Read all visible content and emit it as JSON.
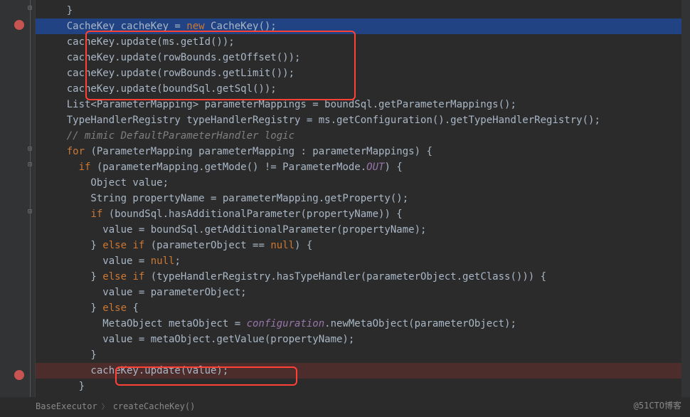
{
  "breadcrumb": {
    "class": "BaseExecutor",
    "method": "createCacheKey()"
  },
  "watermark": "@51CTO博客",
  "code": {
    "l0": "    }",
    "l1_pre": "    CacheKey cacheKey = ",
    "l1_kw": "new",
    "l1_post": " CacheKey();",
    "l2": "    cacheKey.update(ms.getId());",
    "l3": "    cacheKey.update(rowBounds.getOffset());",
    "l4": "    cacheKey.update(rowBounds.getLimit());",
    "l5": "    cacheKey.update(boundSql.getSql());",
    "l6": "    List<ParameterMapping> parameterMappings = boundSql.getParameterMappings();",
    "l7": "    TypeHandlerRegistry typeHandlerRegistry = ms.getConfiguration().getTypeHandlerRegistry();",
    "l8": "    // mimic DefaultParameterHandler logic",
    "l9_kw": "for",
    "l9": " (ParameterMapping parameterMapping : parameterMappings) {",
    "l10_kw": "if",
    "l10_a": " (parameterMapping.getMode() != ParameterMode.",
    "l10_field": "OUT",
    "l10_b": ") {",
    "l11": "        Object value;",
    "l12": "        String propertyName = parameterMapping.getProperty();",
    "l13_kw": "if",
    "l13": " (boundSql.hasAdditionalParameter(propertyName)) {",
    "l14": "          value = boundSql.getAdditionalParameter(propertyName);",
    "l15a": "        } ",
    "l15_kw": "else if",
    "l15b": " (parameterObject == ",
    "l15_kw2": "null",
    "l15c": ") {",
    "l16a": "          value = ",
    "l16_kw": "null",
    "l16b": ";",
    "l17a": "        } ",
    "l17_kw": "else if",
    "l17b": " (typeHandlerRegistry.hasTypeHandler(parameterObject.getClass())) {",
    "l18": "          value = parameterObject;",
    "l19a": "        } ",
    "l19_kw": "else",
    "l19b": " {",
    "l20a": "          MetaObject metaObject = ",
    "l20_field": "configuration",
    "l20b": ".newMetaObject(parameterObject);",
    "l21": "          value = metaObject.getValue(propertyName);",
    "l22": "        }",
    "l23": "        cacheKey.update(value);",
    "l24": "      }"
  }
}
